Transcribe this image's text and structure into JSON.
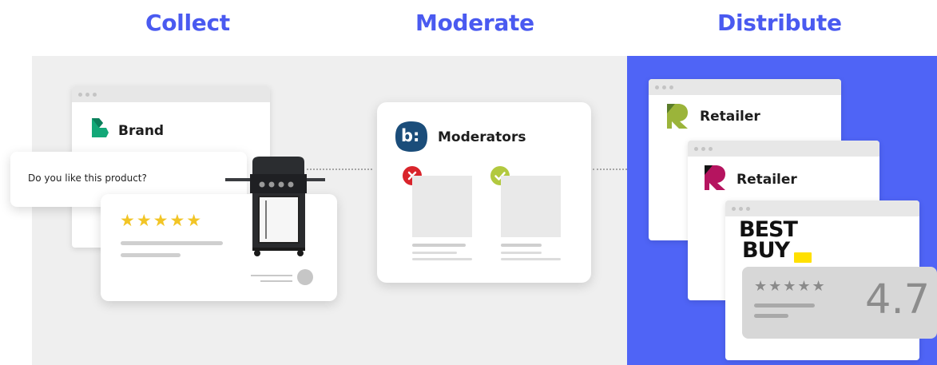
{
  "headings": {
    "collect": "Collect",
    "moderate": "Moderate",
    "distribute": "Distribute"
  },
  "brand": {
    "name": "Brand"
  },
  "question": {
    "text": "Do you like this product?"
  },
  "review": {
    "stars": "★★★★★"
  },
  "moderators": {
    "label": "Moderators",
    "logo_text": "b:"
  },
  "retailers": {
    "first": "Retailer",
    "second": "Retailer"
  },
  "bestbuy": {
    "line1": "BEST",
    "line2": "BUY"
  },
  "rating": {
    "stars": "★★★★★",
    "value": "4.7"
  },
  "colors": {
    "accent": "#4a5af0",
    "blue_panel": "#4f64f6",
    "reject": "#d9242b",
    "approve": "#b2c93f",
    "gold_star": "#f2c526"
  },
  "icons": {
    "reject": "x-circle-icon",
    "approve": "check-circle-icon"
  }
}
